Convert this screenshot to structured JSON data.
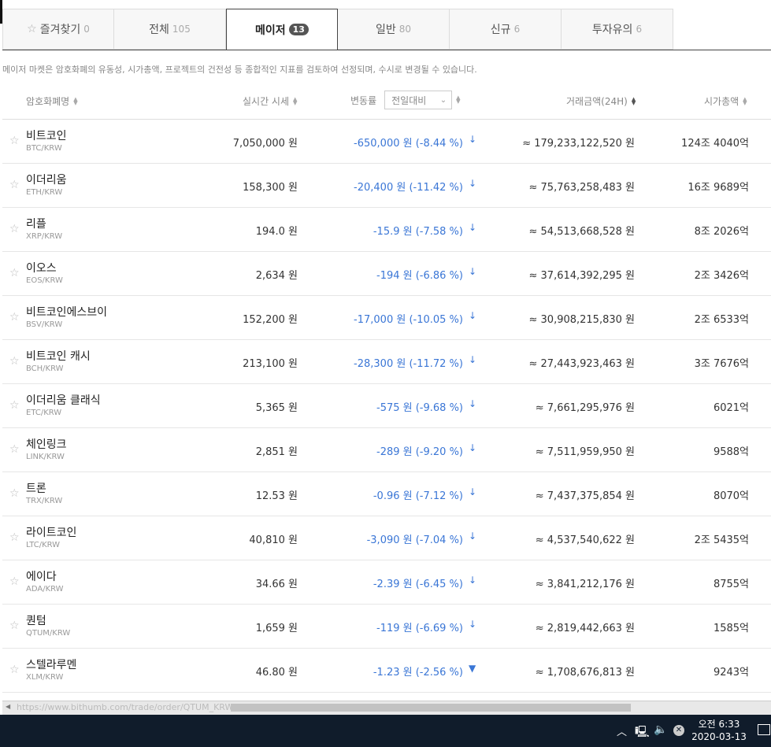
{
  "tabs": [
    {
      "label": "즐겨찾기",
      "count": "0"
    },
    {
      "label": "전체",
      "count": "105"
    },
    {
      "label": "메이저",
      "count": "13"
    },
    {
      "label": "일반",
      "count": "80"
    },
    {
      "label": "신규",
      "count": "6"
    },
    {
      "label": "투자유의",
      "count": "6"
    }
  ],
  "notice": "메이저 마켓은 암호화폐의 유동성, 시가총액, 프로젝트의 건전성 등 종합적인 지표를 검토하여 선정되며, 수시로 변경될 수 있습니다.",
  "header": {
    "name": "암호화폐명",
    "price": "실시간 시세",
    "change": "변동률",
    "change_select": "전일대비",
    "volume": "거래금액(24H)",
    "mcap": "시가총액"
  },
  "rows": [
    {
      "name": "비트코인",
      "symbol": "BTC/KRW",
      "price": "7,050,000 원",
      "change": "-650,000 원 (-8.44 %)",
      "volume": "≈ 179,233,122,520 원",
      "mcap": "124조 4040억"
    },
    {
      "name": "이더리움",
      "symbol": "ETH/KRW",
      "price": "158,300 원",
      "change": "-20,400 원 (-11.42 %)",
      "volume": "≈ 75,763,258,483 원",
      "mcap": "16조 9689억"
    },
    {
      "name": "리플",
      "symbol": "XRP/KRW",
      "price": "194.0 원",
      "change": "-15.9 원 (-7.58 %)",
      "volume": "≈ 54,513,668,528 원",
      "mcap": "8조 2026억"
    },
    {
      "name": "이오스",
      "symbol": "EOS/KRW",
      "price": "2,634 원",
      "change": "-194 원 (-6.86 %)",
      "volume": "≈ 37,614,392,295 원",
      "mcap": "2조 3426억"
    },
    {
      "name": "비트코인에스브이",
      "symbol": "BSV/KRW",
      "price": "152,200 원",
      "change": "-17,000 원 (-10.05 %)",
      "volume": "≈ 30,908,215,830 원",
      "mcap": "2조 6533억"
    },
    {
      "name": "비트코인 캐시",
      "symbol": "BCH/KRW",
      "price": "213,100 원",
      "change": "-28,300 원 (-11.72 %)",
      "volume": "≈ 27,443,923,463 원",
      "mcap": "3조 7676억"
    },
    {
      "name": "이더리움 클래식",
      "symbol": "ETC/KRW",
      "price": "5,365 원",
      "change": "-575 원 (-9.68 %)",
      "volume": "≈ 7,661,295,976 원",
      "mcap": "6021억"
    },
    {
      "name": "체인링크",
      "symbol": "LINK/KRW",
      "price": "2,851 원",
      "change": "-289 원 (-9.20 %)",
      "volume": "≈ 7,511,959,950 원",
      "mcap": "9588억"
    },
    {
      "name": "트론",
      "symbol": "TRX/KRW",
      "price": "12.53 원",
      "change": "-0.96 원 (-7.12 %)",
      "volume": "≈ 7,437,375,854 원",
      "mcap": "8070억"
    },
    {
      "name": "라이트코인",
      "symbol": "LTC/KRW",
      "price": "40,810 원",
      "change": "-3,090 원 (-7.04 %)",
      "volume": "≈ 4,537,540,622 원",
      "mcap": "2조 5435억"
    },
    {
      "name": "에이다",
      "symbol": "ADA/KRW",
      "price": "34.66 원",
      "change": "-2.39 원 (-6.45 %)",
      "volume": "≈ 3,841,212,176 원",
      "mcap": "8755억"
    },
    {
      "name": "퀀텀",
      "symbol": "QTUM/KRW",
      "price": "1,659 원",
      "change": "-119 원 (-6.69 %)",
      "volume": "≈ 2,819,442,663 원",
      "mcap": "1585억"
    },
    {
      "name": "스텔라루멘",
      "symbol": "XLM/KRW",
      "price": "46.80 원",
      "change": "-1.23 원 (-2.56 %)",
      "volume": "≈ 1,708,676,813 원",
      "mcap": "9243억"
    }
  ],
  "status_url": "https://www.bithumb.com/trade/order/QTUM_KRW",
  "taskbar": {
    "ampm_time": "오전 6:33",
    "date": "2020-03-13"
  }
}
